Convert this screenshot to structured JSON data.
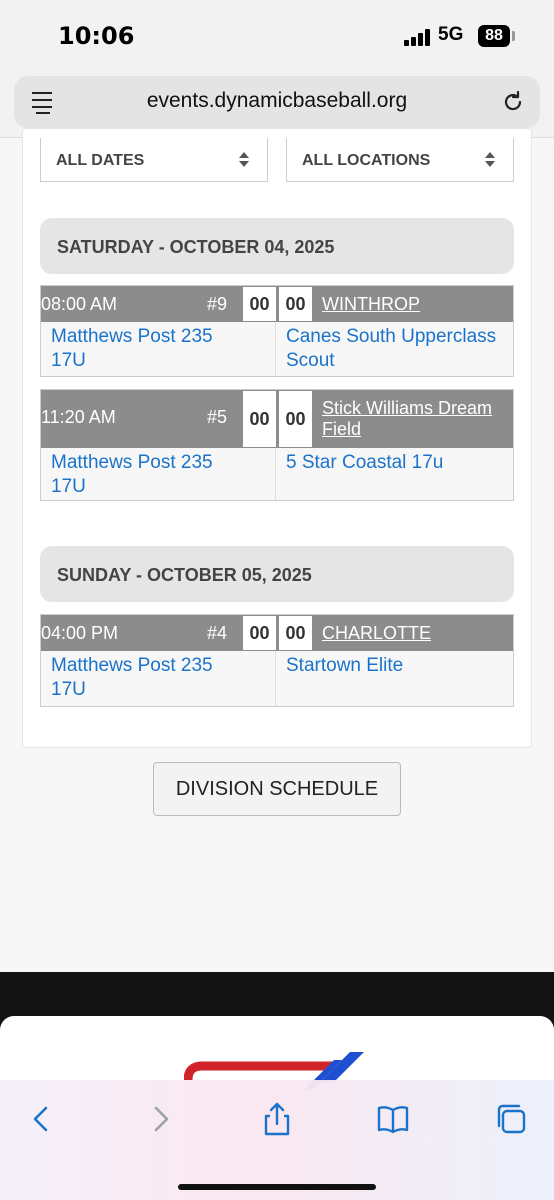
{
  "status": {
    "time": "10:06",
    "network": "5G",
    "battery": "88"
  },
  "browser": {
    "url": "events.dynamicbaseball.org"
  },
  "filters": {
    "dates": "ALL DATES",
    "locations": "ALL LOCATIONS"
  },
  "days": [
    {
      "header": "SATURDAY - OCTOBER 04, 2025",
      "games": [
        {
          "time": "08:00 AM",
          "number": "#9",
          "score_home": "00",
          "score_away": "00",
          "location": "WINTHROP",
          "team_a": "Matthews Post 235 17U",
          "team_b": "Canes South Upperclass Scout"
        },
        {
          "time": "11:20 AM",
          "number": "#5",
          "score_home": "00",
          "score_away": "00",
          "location": "Stick Williams Dream Field",
          "team_a": "Matthews Post 235 17U",
          "team_b": "5 Star Coastal 17u"
        }
      ]
    },
    {
      "header": "SUNDAY - OCTOBER 05, 2025",
      "games": [
        {
          "time": "04:00 PM",
          "number": "#4",
          "score_home": "00",
          "score_away": "00",
          "location": "CHARLOTTE",
          "team_a": "Matthews Post 235 17U",
          "team_b": "Startown Elite"
        }
      ]
    }
  ],
  "division_button": "DIVISION SCHEDULE",
  "toolbar": {
    "icons": [
      "back-icon",
      "forward-icon",
      "share-icon",
      "bookmarks-icon",
      "tabs-icon"
    ]
  },
  "colors": {
    "link": "#1a73c9",
    "game_header": "#8c8c8c",
    "day_header": "#e5e5e5",
    "toolbar_icon": "#1a73c9"
  }
}
